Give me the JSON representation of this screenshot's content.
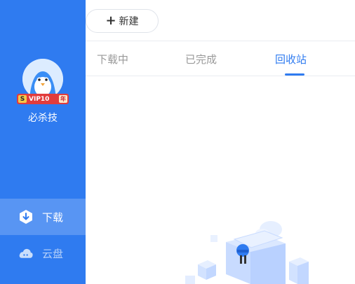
{
  "colors": {
    "sidebar_bg": "#2f7bf0",
    "accent": "#2f7bf0",
    "tab_inactive": "#999999"
  },
  "sidebar": {
    "user": {
      "name": "必杀技",
      "vip_badge": "VIP10",
      "vip_year": "年"
    },
    "nav": [
      {
        "label": "下载",
        "icon": "download-icon",
        "active": true
      },
      {
        "label": "云盘",
        "icon": "cloud-icon",
        "active": false
      }
    ]
  },
  "toolbar": {
    "new_button_label": "新建"
  },
  "tabs": [
    {
      "label": "下载中",
      "active": false
    },
    {
      "label": "已完成",
      "active": false
    },
    {
      "label": "回收站",
      "active": true
    }
  ]
}
